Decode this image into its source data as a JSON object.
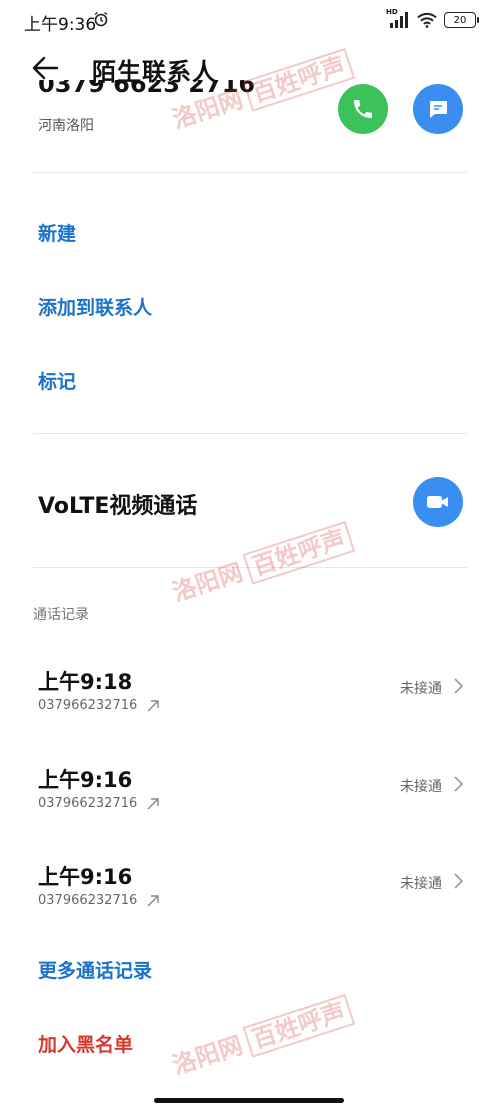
{
  "status_bar": {
    "time": "上午9:36",
    "battery": "20",
    "network_badge": "HD"
  },
  "header": {
    "title": "陌生联系人"
  },
  "contact": {
    "phone": "0379 6623 2716",
    "location": "河南洛阳"
  },
  "actions": {
    "new": "新建",
    "add_to_contacts": "添加到联系人",
    "mark": "标记"
  },
  "volte": {
    "label": "VoLTE视频通话"
  },
  "call_log": {
    "section_title": "通话记录",
    "entries": [
      {
        "time": "上午9:18",
        "number": "037966232716",
        "status": "未接通"
      },
      {
        "time": "上午9:16",
        "number": "037966232716",
        "status": "未接通"
      },
      {
        "time": "上午9:16",
        "number": "037966232716",
        "status": "未接通"
      }
    ],
    "more": "更多通话记录"
  },
  "blacklist": "加入黑名单",
  "watermark": {
    "text": "洛阳网",
    "boxed": "百姓呼声"
  },
  "colors": {
    "link": "#1a73c9",
    "danger": "#d63a2f",
    "call_green": "#3cc25a",
    "action_blue": "#3a8ef0"
  },
  "icons": [
    "alarm-icon",
    "signal-icon",
    "wifi-icon",
    "battery-icon",
    "back-arrow-icon",
    "phone-icon",
    "message-icon",
    "video-camera-icon",
    "outgoing-call-icon",
    "chevron-right-icon"
  ]
}
